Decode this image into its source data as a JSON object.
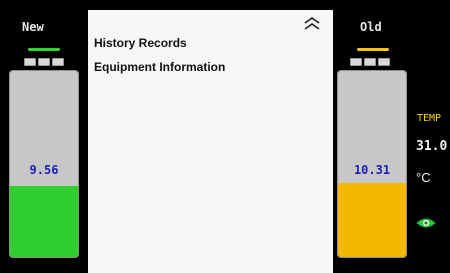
{
  "left": {
    "title": "New",
    "value": "9.56",
    "fill_percent": 38,
    "underline_color": "#2dd52d",
    "fill_color": "#2fcf2f"
  },
  "center": {
    "items": [
      {
        "label": "History Records"
      },
      {
        "label": "Equipment Information"
      }
    ],
    "collapse_icon": "double-chevron-up-icon"
  },
  "right": {
    "title": "Old",
    "value": "10.31",
    "fill_percent": 40,
    "underline_color": "#ffc400",
    "fill_color": "#f5b800",
    "temp_label": "TEMP",
    "temp_value": "31.0",
    "temp_unit": "°C",
    "eye_icon": "eye-icon",
    "eye_color": "#2ecc40"
  }
}
